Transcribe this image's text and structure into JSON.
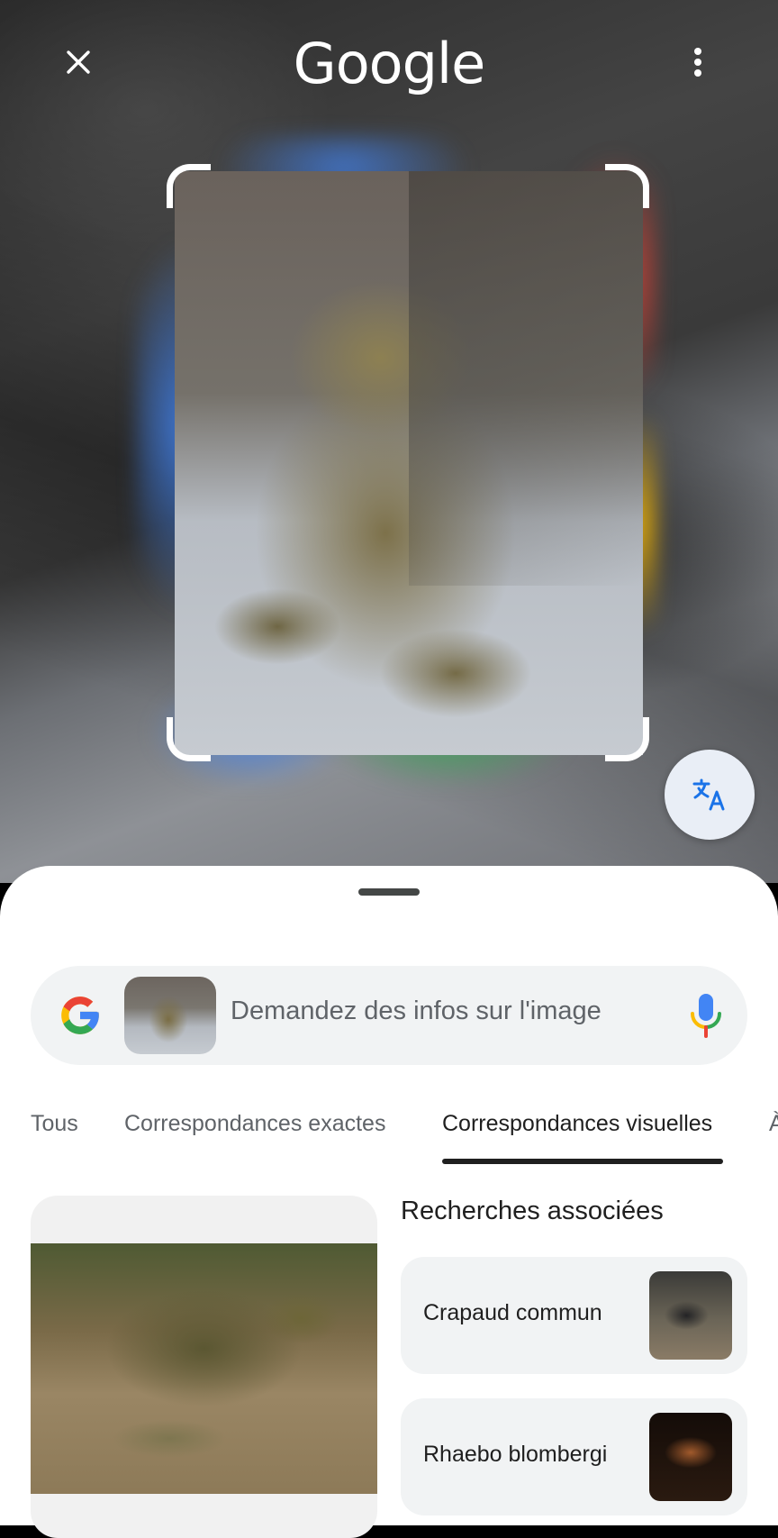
{
  "header": {
    "logo_text": "Google",
    "close_icon": "close-icon",
    "menu_icon": "more-vert-icon"
  },
  "translate_button": {
    "icon": "translate-icon"
  },
  "search": {
    "placeholder": "Demandez des infos sur l'image",
    "mic_icon": "mic-icon"
  },
  "tabs": [
    {
      "label": "Tous"
    },
    {
      "label": "Correspondances exactes"
    },
    {
      "label": "Correspondances visuelles",
      "active": true
    },
    {
      "label": "À"
    }
  ],
  "related": {
    "title": "Recherches associées",
    "items": [
      {
        "label": "Crapaud commun"
      },
      {
        "label": "Rhaebo blombergi"
      }
    ]
  },
  "colors": {
    "google_blue": "#4285F4",
    "google_red": "#EA4335",
    "google_yellow": "#FBBC05",
    "google_green": "#34A853",
    "translate_icon": "#1a73e8"
  }
}
